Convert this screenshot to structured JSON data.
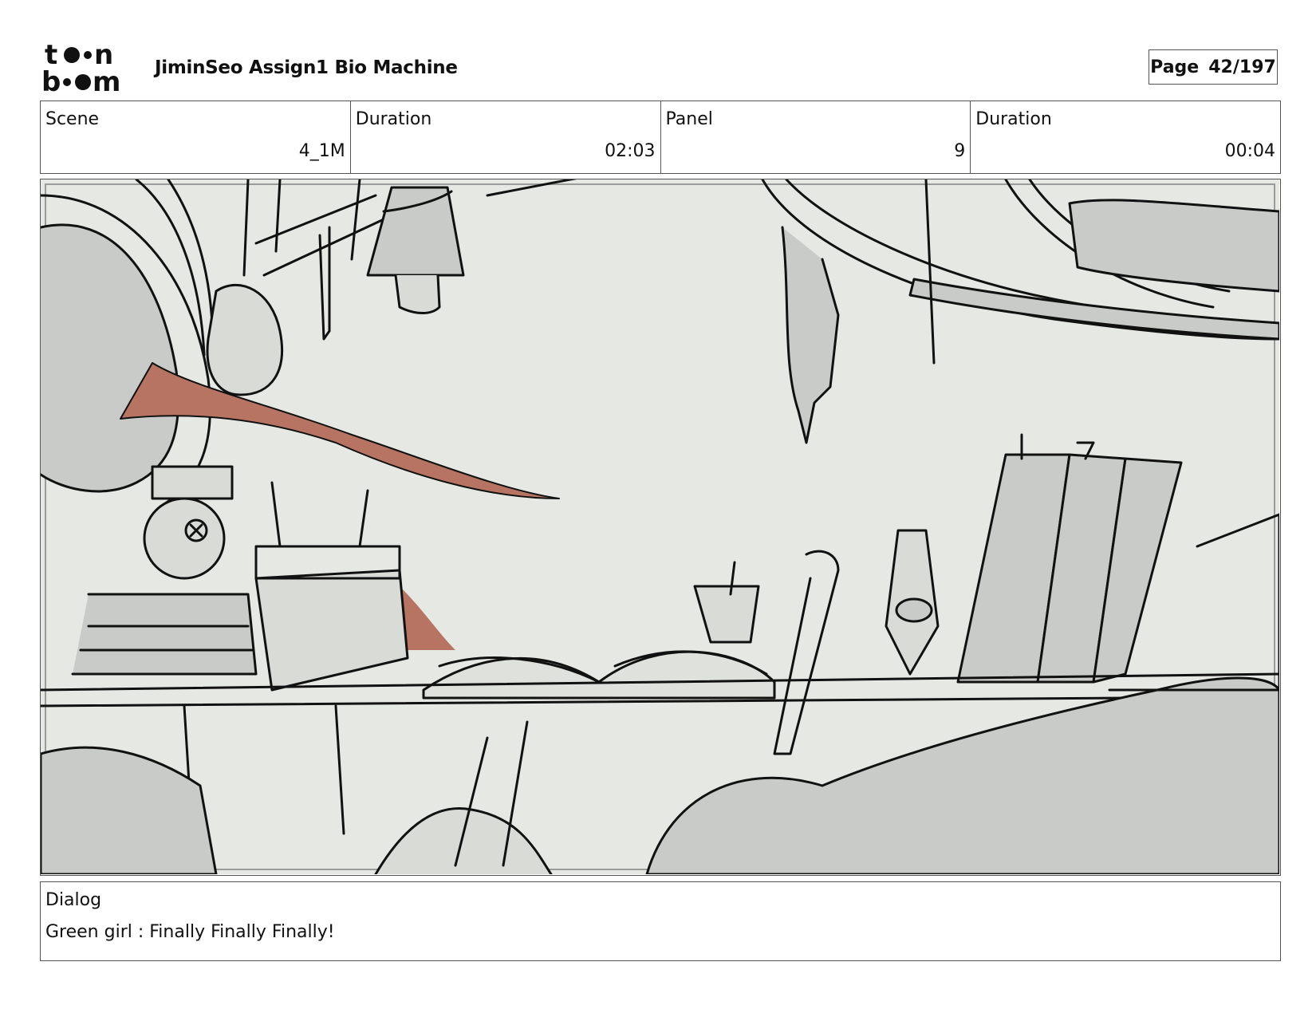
{
  "header": {
    "logo_icon": "toonboom-logo",
    "project_title": "JiminSeo Assign1 Bio Machine",
    "page_label": "Page",
    "page_number": "42/197"
  },
  "info": {
    "scene_label": "Scene",
    "scene_value": "4_1M",
    "scene_duration_label": "Duration",
    "scene_duration_value": "02:03",
    "panel_label": "Panel",
    "panel_value": "9",
    "panel_duration_label": "Duration",
    "panel_duration_value": "00:04"
  },
  "panel": {
    "image_icon": "storyboard-sketch-laboratory-shelf",
    "accent_color": "#b87462",
    "background_color": "#e6e8e3",
    "shade_color": "#c9cbc8"
  },
  "dialog": {
    "label": "Dialog",
    "text": "Green girl : Finally Finally Finally!"
  }
}
